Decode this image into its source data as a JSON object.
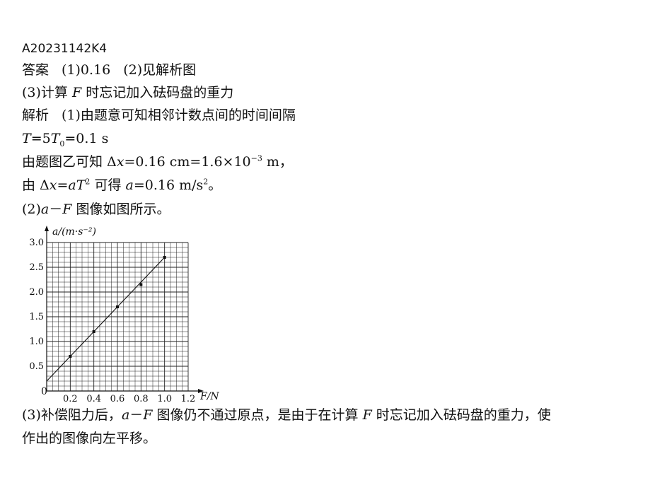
{
  "doc": {
    "id": "A20231142K4",
    "answer_label": "答案",
    "answer_p1": "(1)0.16",
    "answer_p2": "(2)见解析图",
    "answer_line2": "计算",
    "answer_line2_rest": "时忘记加入砝码盘的重力",
    "analysis_label": "解析",
    "analysis_p1": "(1)由题意可知相邻计数点间的时间间隔",
    "eq_T": "=5",
    "eq_T2": "=0.1 s",
    "dx_line_pre": "由题图乙可知 Δ",
    "dx_line_mid": "=0.16 cm=1.6×10",
    "dx_line_exp": "−3",
    "dx_line_post": " m，",
    "a_line_pre": "由 Δ",
    "a_line_mid": "=",
    "a_line_post": " 可得 ",
    "a_line_val": "=0.16 m/s",
    "a_line_end": "。",
    "p2_line": "图像如图所示。",
    "p3_line1": "补偿阻力后，",
    "p3_line1_b": "图像仍不通过原点，是由于在计算",
    "p3_line1_c": "时忘记加入砝码盘的重力，使",
    "p3_line2": "作出的图像向左平移。"
  },
  "chart_data": {
    "type": "scatter",
    "ylabel": "a/(m·s⁻²)",
    "xlabel": "F/N",
    "origin_label": "0",
    "xlim": [
      0,
      1.2
    ],
    "ylim": [
      0,
      3.0
    ],
    "x_ticks": [
      "0.2",
      "0.4",
      "0.6",
      "0.8",
      "1.0",
      "1.2"
    ],
    "y_ticks": [
      "0.5",
      "1.0",
      "1.5",
      "2.0",
      "2.5",
      "3.0"
    ],
    "grid": true,
    "points": [
      {
        "x": 0.2,
        "y": 0.7
      },
      {
        "x": 0.4,
        "y": 1.2
      },
      {
        "x": 0.6,
        "y": 1.7
      },
      {
        "x": 0.8,
        "y": 2.15
      },
      {
        "x": 1.0,
        "y": 2.7
      }
    ],
    "fit_line": {
      "x0": 0,
      "y0": 0.2,
      "x1": 1.0,
      "y1": 2.7
    }
  }
}
